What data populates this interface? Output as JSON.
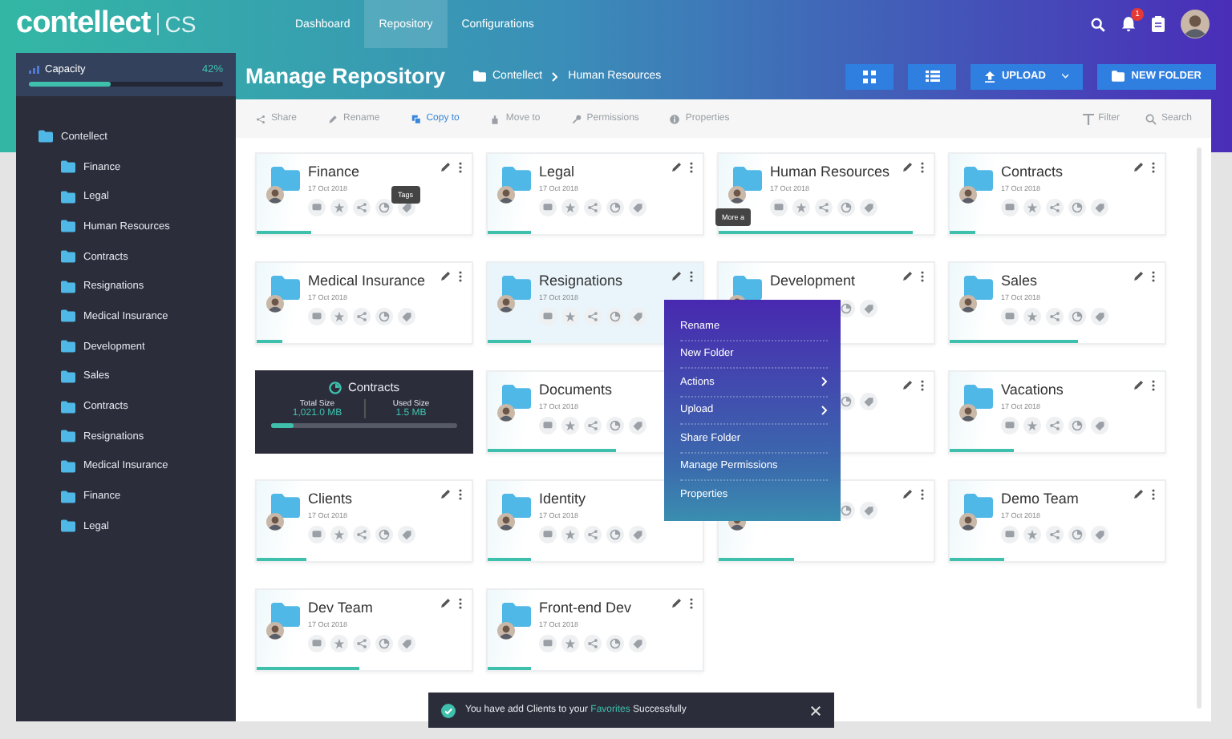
{
  "nav": {
    "logo": "contellect",
    "product": "CS",
    "tabs": [
      {
        "label": "Dashboard",
        "selected": false
      },
      {
        "label": "Repository",
        "selected": true
      },
      {
        "label": "Configurations",
        "selected": false
      }
    ],
    "notifications": "1"
  },
  "sidebar": {
    "capacity": {
      "label": "Capacity",
      "reading": "42%",
      "level": 0.42
    },
    "tree": [
      {
        "label": "Contellect",
        "children": [
          {
            "label": "Finance"
          },
          {
            "label": "Legal"
          },
          {
            "label": "Human Resources"
          },
          {
            "label": "Contracts"
          },
          {
            "label": "Resignations"
          },
          {
            "label": "Medical Insurance"
          },
          {
            "label": "Development"
          },
          {
            "label": "Sales"
          },
          {
            "label": "Contracts"
          },
          {
            "label": "Resignations"
          },
          {
            "label": "Medical Insurance"
          },
          {
            "label": "Finance"
          },
          {
            "label": "Legal"
          }
        ]
      }
    ]
  },
  "header": {
    "title": "Manage Repository",
    "breadcrumb": [
      "Contellect",
      "Human Resources"
    ],
    "buttons": [
      {
        "kind": "grid"
      },
      {
        "kind": "list"
      },
      {
        "kind": "upload",
        "label": "UPLOAD"
      },
      {
        "kind": "new-folder",
        "label": "NEW FOLDER"
      }
    ]
  },
  "toolbar": {
    "actions": [
      {
        "kind": "share",
        "label": "Share",
        "selected": false
      },
      {
        "kind": "rename",
        "label": "Rename",
        "selected": false
      },
      {
        "kind": "copy",
        "label": "Copy to",
        "selected": true
      },
      {
        "kind": "move",
        "label": "Move to",
        "selected": false
      },
      {
        "kind": "permissions",
        "label": "Permissions",
        "selected": false
      },
      {
        "kind": "properties",
        "label": "Properties",
        "selected": false
      }
    ],
    "filter": "Filter",
    "search": "Search"
  },
  "cards": [
    {
      "kind": "folder",
      "name": "Finance",
      "date": "17 Oct 2018",
      "level": 0.25,
      "highlighted": false,
      "tag_tooltip": "Tags"
    },
    {
      "kind": "folder",
      "name": "Legal",
      "date": "17 Oct 2018",
      "level": 0.2,
      "highlighted": false
    },
    {
      "kind": "folder",
      "name": "Human Resources",
      "date": "17 Oct 2018",
      "level": 0.9,
      "highlighted": false,
      "avatar_tooltip": "More a"
    },
    {
      "kind": "folder",
      "name": "Contracts",
      "date": "17 Oct 2018",
      "level": 0.12,
      "highlighted": false
    },
    {
      "kind": "folder",
      "name": "Medical Insurance",
      "date": "17 Oct 2018",
      "level": 0.12,
      "highlighted": false
    },
    {
      "kind": "folder",
      "name": "Resignations",
      "date": "17 Oct 2018",
      "level": 0.2,
      "highlighted": true
    },
    {
      "kind": "folder",
      "name": "Development",
      "highlighted": false
    },
    {
      "kind": "folder",
      "name": "Sales",
      "date": "17 Oct 2018",
      "level": 0.6,
      "highlighted": false
    },
    {
      "kind": "stats",
      "name": "Contracts",
      "total_label": "Total Size",
      "total": "1,021.0 MB",
      "used_label": "Used Size",
      "used": "1.5 MB",
      "level": 0.12
    },
    {
      "kind": "folder",
      "name": "Documents",
      "date": "17 Oct 2018",
      "level": 0.6,
      "highlighted": false
    },
    {
      "kind": "folder",
      "highlighted": false
    },
    {
      "kind": "folder",
      "name": "Vacations",
      "date": "17 Oct 2018",
      "level": 0.3,
      "highlighted": false
    },
    {
      "kind": "folder",
      "name": "Clients",
      "date": "17 Oct 2018",
      "level": 0.23,
      "highlighted": false
    },
    {
      "kind": "folder",
      "name": "Identity",
      "date": "17 Oct 2018",
      "level": 0.2,
      "highlighted": false
    },
    {
      "kind": "folder",
      "level": 0.35,
      "highlighted": false
    },
    {
      "kind": "folder",
      "name": "Demo Team",
      "date": "17 Oct 2018",
      "level": 0.25,
      "highlighted": false
    },
    {
      "kind": "folder",
      "name": "Dev Team",
      "date": "17 Oct 2018",
      "level": 0.48,
      "highlighted": false
    },
    {
      "kind": "folder",
      "name": "Front-end Dev",
      "date": "17 Oct 2018",
      "level": 0.2,
      "highlighted": false
    }
  ],
  "context_menu": [
    {
      "label": "Rename",
      "submenu": false
    },
    {
      "label": "New Folder",
      "submenu": false
    },
    {
      "label": "Actions",
      "submenu": true
    },
    {
      "label": "Upload",
      "submenu": true
    },
    {
      "label": "Share Folder",
      "submenu": false
    },
    {
      "label": "Manage Permissions",
      "submenu": false
    },
    {
      "label": "Properties",
      "submenu": false
    }
  ],
  "toast": {
    "message": "You have add Clients to your **Favorites** Successfully"
  }
}
